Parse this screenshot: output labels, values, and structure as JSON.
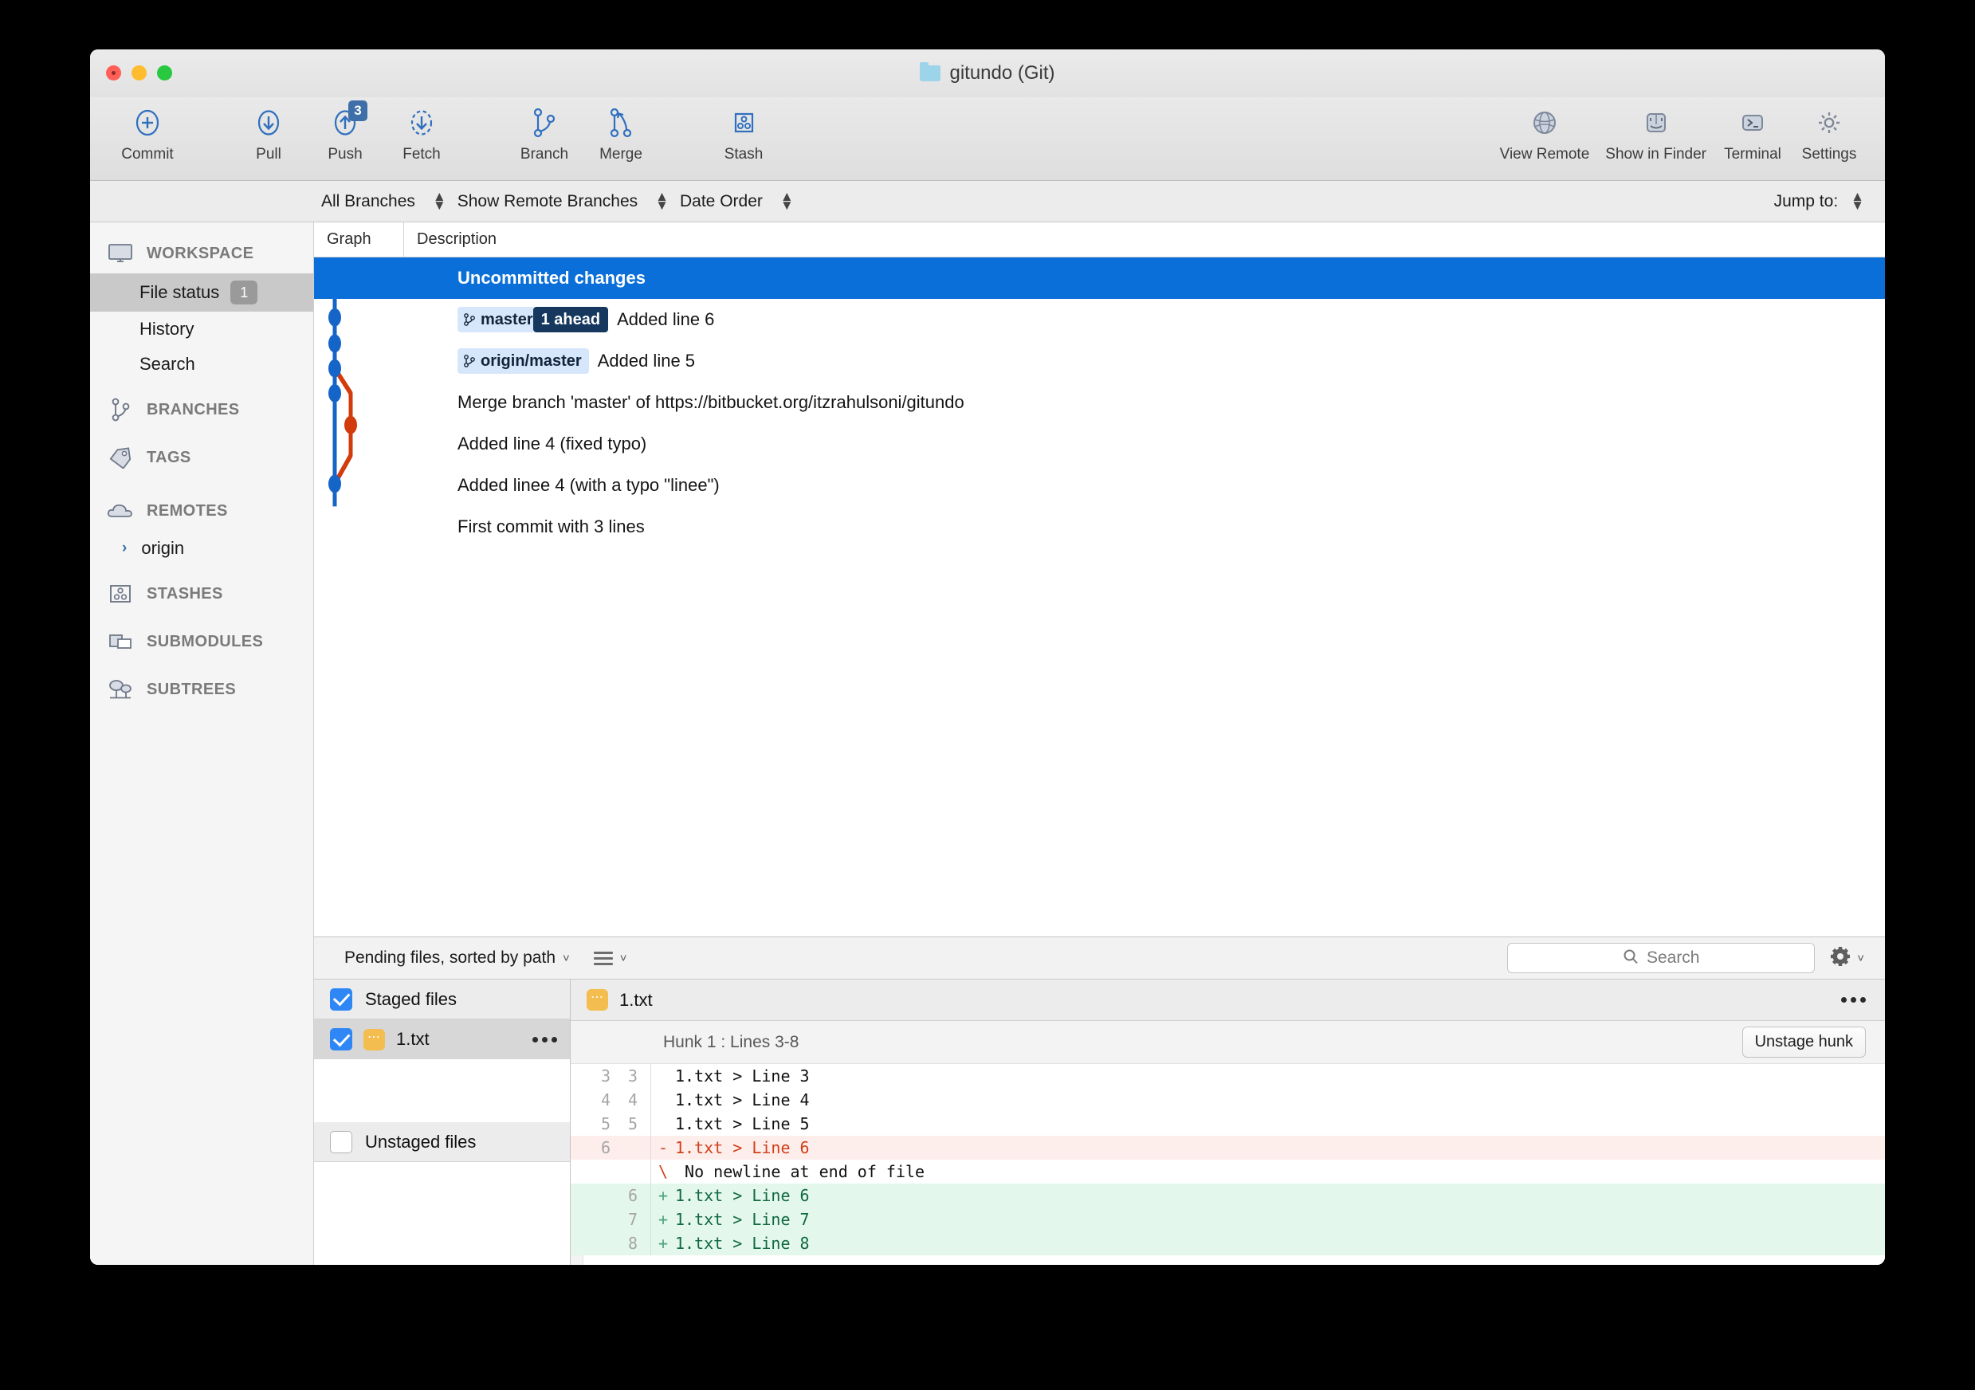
{
  "window": {
    "title": "gitundo (Git)",
    "traffic_lights": [
      "close",
      "minimize",
      "maximize"
    ]
  },
  "toolbar": {
    "left_buttons": [
      {
        "label": "Commit",
        "icon": "commit-plus-circle-icon"
      },
      {
        "label": "Pull",
        "icon": "pull-down-arrow-icon"
      },
      {
        "label": "Push",
        "icon": "push-up-arrow-icon",
        "badge": "3"
      },
      {
        "label": "Fetch",
        "icon": "fetch-dashed-circle-icon"
      },
      {
        "label": "Branch",
        "icon": "branch-icon"
      },
      {
        "label": "Merge",
        "icon": "merge-icon"
      },
      {
        "label": "Stash",
        "icon": "stash-box-icon"
      }
    ],
    "right_buttons": [
      {
        "label": "View Remote",
        "icon": "globe-icon"
      },
      {
        "label": "Show in Finder",
        "icon": "finder-face-icon"
      },
      {
        "label": "Terminal",
        "icon": "terminal-prompt-icon"
      },
      {
        "label": "Settings",
        "icon": "gear-icon"
      }
    ]
  },
  "filterbar": {
    "branch_filter": "All Branches",
    "remote_filter": "Show Remote Branches",
    "order_filter": "Date Order",
    "jump_to_label": "Jump to:"
  },
  "columns": {
    "graph": "Graph",
    "description": "Description"
  },
  "sidebar": {
    "sections": [
      {
        "label": "WORKSPACE",
        "icon": "monitor-icon"
      },
      {
        "label": "BRANCHES",
        "icon": "branch-icon"
      },
      {
        "label": "TAGS",
        "icon": "tag-icon"
      },
      {
        "label": "REMOTES",
        "icon": "cloud-icon"
      },
      {
        "label": "STASHES",
        "icon": "stash-box-icon"
      },
      {
        "label": "SUBMODULES",
        "icon": "submodule-icon"
      },
      {
        "label": "SUBTREES",
        "icon": "subtree-trees-icon"
      }
    ],
    "workspace_items": [
      {
        "label": "File status",
        "badge": "1",
        "selected": true
      },
      {
        "label": "History",
        "badge": "",
        "selected": false
      },
      {
        "label": "Search",
        "badge": "",
        "selected": false
      }
    ],
    "remotes_items": [
      {
        "label": "origin",
        "expanded": false
      }
    ]
  },
  "commits": [
    {
      "description": "Uncommitted changes",
      "selected": true,
      "refs": []
    },
    {
      "description": "Added line 6",
      "selected": false,
      "refs": [
        {
          "name": "master",
          "ahead": "1 ahead"
        }
      ]
    },
    {
      "description": "Added line 5",
      "selected": false,
      "refs": [
        {
          "name": "origin/master",
          "ahead": ""
        }
      ]
    },
    {
      "description": "Merge branch 'master' of https://bitbucket.org/itzrahulsoni/gitundo",
      "selected": false,
      "refs": []
    },
    {
      "description": "Added line 4 (fixed typo)",
      "selected": false,
      "refs": []
    },
    {
      "description": "Added linee 4 (with a typo \"linee\")",
      "selected": false,
      "refs": []
    },
    {
      "description": "First commit with 3 lines",
      "selected": false,
      "refs": []
    }
  ],
  "bottom_bar": {
    "pending_menu": "Pending files, sorted by path",
    "view_mode_icon": "list-view-icon",
    "search_placeholder": "Search",
    "gear_icon": "gear-icon"
  },
  "file_panel": {
    "staged_header": {
      "label": "Staged files",
      "checked": true
    },
    "staged_files": [
      {
        "name": "1.txt",
        "checked": true,
        "status_icon": "modified-file-icon"
      }
    ],
    "unstaged_header": {
      "label": "Unstaged files",
      "checked": false
    },
    "unstaged_files": []
  },
  "diff_panel": {
    "filename": "1.txt",
    "file_icon": "modified-file-icon",
    "more_icon": "more-dots-icon",
    "hunk_label": "Hunk 1 : Lines 3-8",
    "unstage_button": "Unstage hunk",
    "lines": [
      {
        "old": "3",
        "new": "3",
        "sign": "",
        "text": "1.txt > Line 3",
        "type": "ctx"
      },
      {
        "old": "4",
        "new": "4",
        "sign": "",
        "text": "1.txt > Line 4",
        "type": "ctx"
      },
      {
        "old": "5",
        "new": "5",
        "sign": "",
        "text": "1.txt > Line 5",
        "type": "ctx"
      },
      {
        "old": "6",
        "new": "",
        "sign": "-",
        "text": "1.txt > Line 6",
        "type": "del"
      },
      {
        "old": "",
        "new": "",
        "sign": "\\",
        "text": " No newline at end of file",
        "type": "nonl"
      },
      {
        "old": "",
        "new": "6",
        "sign": "+",
        "text": "1.txt > Line 6",
        "type": "add"
      },
      {
        "old": "",
        "new": "7",
        "sign": "+",
        "text": "1.txt > Line 7",
        "type": "add"
      },
      {
        "old": "",
        "new": "8",
        "sign": "+",
        "text": "1.txt > Line 8",
        "type": "add"
      }
    ]
  },
  "colors": {
    "graph_main": "#1565c8",
    "graph_branch": "#d33b0c",
    "selection_blue": "#0a6fd8",
    "ref_chip_bg": "#d6e6fb",
    "ahead_chip_bg": "#16375e",
    "add_bg": "#e4f7ed",
    "del_bg": "#fdeeec",
    "accent_icon": "#3a6fa8"
  }
}
